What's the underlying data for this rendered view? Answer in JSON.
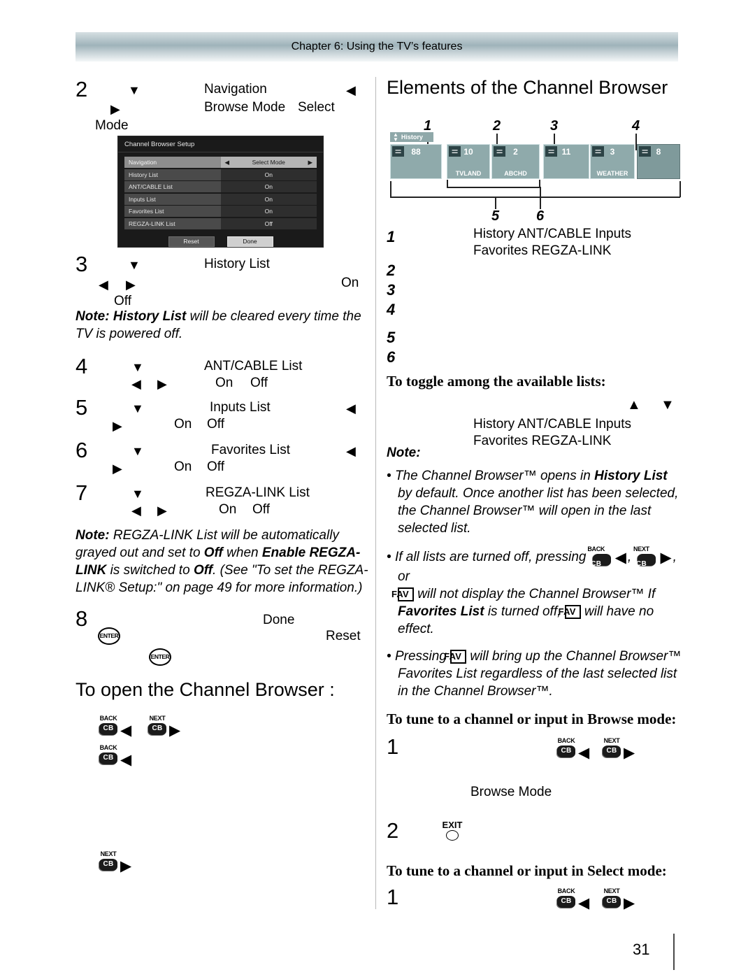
{
  "header": {
    "chapter_title": "Chapter 6: Using the TV’s features"
  },
  "page": {
    "number": "31"
  },
  "left_column": {
    "step2": {
      "num": "2",
      "down_arrow": "▼",
      "right_arrow": "▶",
      "label_navigation": "Navigation",
      "left_arrow": "◀",
      "label_browse_mode": "Browse Mode",
      "label_select": "Select",
      "label_mode": "Mode"
    },
    "osd_menu": {
      "title": "Channel Browser Setup",
      "rows": [
        {
          "label": "Navigation",
          "value": "Select Mode",
          "selected": true,
          "left_arrow": "◀",
          "right_arrow": "▶"
        },
        {
          "label": "History List",
          "value": "On",
          "selected": false
        },
        {
          "label": "ANT/CABLE List",
          "value": "On",
          "selected": false
        },
        {
          "label": "Inputs List",
          "value": "On",
          "selected": false
        },
        {
          "label": "Favorites List",
          "value": "On",
          "selected": false
        },
        {
          "label": "REGZA-LINK List",
          "value": "Off",
          "selected": false
        }
      ],
      "reset_button": "Reset",
      "done_button": "Done"
    },
    "step3": {
      "num": "3",
      "down_arrow": "▼",
      "label": "History List",
      "left_arrow": "◀",
      "right_arrow": "▶",
      "on": "On",
      "off": "Off"
    },
    "note_history": {
      "bold": "Note: History List",
      "rest": " will be cleared every time the TV is powered off."
    },
    "step4": {
      "num": "4",
      "down_arrow": "▼",
      "label": "ANT/CABLE List",
      "left_arrow": "◀",
      "right_arrow": "▶",
      "on": "On",
      "off": "Off"
    },
    "step5": {
      "num": "5",
      "down_arrow": "▼",
      "label": "Inputs List",
      "left_arrow": "◀",
      "right_arrow": "▶",
      "on": "On",
      "off": "Off"
    },
    "step6": {
      "num": "6",
      "down_arrow": "▼",
      "label": "Favorites List",
      "left_arrow": "◀",
      "right_arrow": "▶",
      "on": "On",
      "off": "Off"
    },
    "step7": {
      "num": "7",
      "down_arrow": "▼",
      "label": "REGZA-LINK List",
      "left_arrow": "◀",
      "right_arrow": "▶",
      "on": "On",
      "off": "Off"
    },
    "note_regza": {
      "p1_bold": "Note:",
      "p1": " REGZA-LINK List will be automatically grayed out and set to ",
      "off1": "Off",
      "p2": " when ",
      "enable_bold": "Enable REGZA-LINK",
      "p3": " is switched to ",
      "off2": "Off",
      "p4": ". (See \"To set the REGZA-LINK® Setup:\" on page 49 for more information.)"
    },
    "step8": {
      "num": "8",
      "done": "Done",
      "reset": "Reset"
    },
    "open_heading": "To open the Channel Browser :",
    "keys": {
      "back_label": "BACK",
      "next_label": "NEXT",
      "cb_label": "CB",
      "left_arrow": "◀",
      "right_arrow": "▶"
    }
  },
  "right_column": {
    "elements_heading": "Elements of the Channel Browser",
    "diagram": {
      "callouts": [
        "1",
        "2",
        "3",
        "4",
        "5",
        "6"
      ],
      "history_tab": "History",
      "tiles": [
        {
          "number": "88",
          "name": "",
          "dim": false
        },
        {
          "number": "10",
          "name": "TVLAND",
          "dim": false
        },
        {
          "number": "2",
          "name": "ABCHD",
          "dim": false
        },
        {
          "number": "11",
          "name": "",
          "dim": false
        },
        {
          "number": "3",
          "name": "WEATHER",
          "dim": false
        },
        {
          "number": "8",
          "name": "",
          "dim": true
        }
      ]
    },
    "numbered_items": [
      {
        "num": "1",
        "text": "History ANT/CABLE Inputs Favorites REGZA-LINK"
      },
      {
        "num": "2",
        "text": ""
      },
      {
        "num": "3",
        "text": ""
      },
      {
        "num": "4",
        "text": ""
      },
      {
        "num": "5",
        "text": ""
      },
      {
        "num": "6",
        "text": ""
      }
    ],
    "toggle_heading": "To toggle among the available lists:",
    "toggle_line": {
      "up_arrow": "▲",
      "down_arrow": "▼",
      "text": "History ANT/CABLE Inputs Favorites REGZA-LINK"
    },
    "note_label": "Note:",
    "bullets": [
      {
        "pre": "The Channel Browser™ opens in ",
        "bold": "History List",
        "post": " by default. Once another list has been selected, the Channel Browser™ will open in the last selected list."
      }
    ],
    "bullet2": {
      "p1": "If all lists are turned off, pressing ",
      "p2": ", ",
      "p3": ", or ",
      "p4": " will not display the Channel Browser™ If ",
      "bold": "Favorites List",
      "p5": " is turned off, ",
      "p6": " will have no effect."
    },
    "bullet3": {
      "p1": "Pressing ",
      "p2": " will bring up the Channel Browser™ Favorites List regardless of the last selected list in the Channel Browser™."
    },
    "browse_heading": "To tune to a channel or input in Browse mode:",
    "browse_step1": {
      "num": "1",
      "browse_mode_label": "Browse Mode"
    },
    "browse_step2": {
      "num": "2",
      "exit_label": "EXIT"
    },
    "select_heading": "To tune to a channel or input in Select mode:",
    "select_step1": {
      "num": "1"
    },
    "fav_label": "FAV"
  }
}
